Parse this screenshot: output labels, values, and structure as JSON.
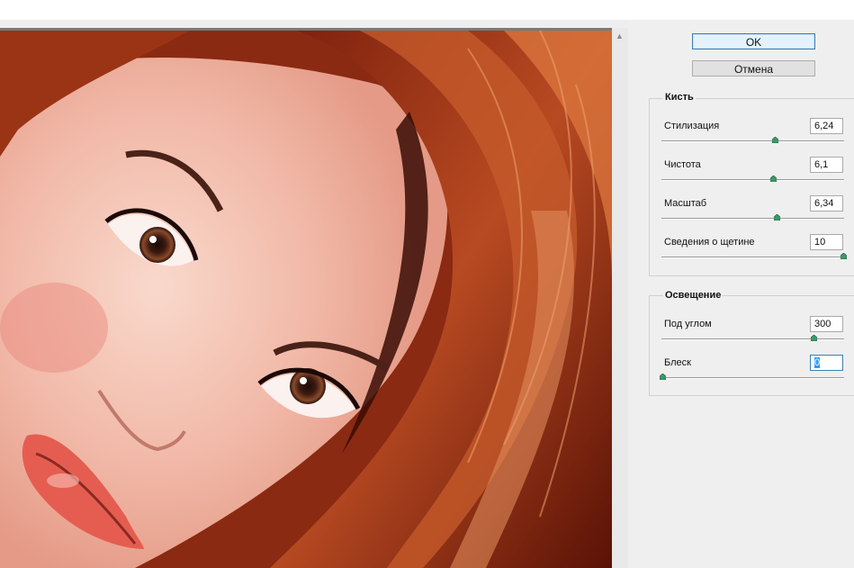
{
  "buttons": {
    "ok": "OK",
    "cancel": "Отмена"
  },
  "brush": {
    "title": "Кисть",
    "params": [
      {
        "label": "Стилизация",
        "value": "6,24",
        "level": 0.62
      },
      {
        "label": "Чистота",
        "value": "6,1",
        "level": 0.61
      },
      {
        "label": "Масштаб",
        "value": "6,34",
        "level": 0.63
      },
      {
        "label": "Сведения о щетине",
        "value": "10",
        "level": 1.0
      }
    ]
  },
  "lighting": {
    "title": "Освещение",
    "params": [
      {
        "label": "Под углом",
        "value": "300",
        "level": 0.83
      },
      {
        "label": "Блеск",
        "value": "0",
        "level": 0.0
      }
    ]
  },
  "colors": {
    "thumb": "#3a9a6a",
    "accent": "#3c7fb1"
  }
}
